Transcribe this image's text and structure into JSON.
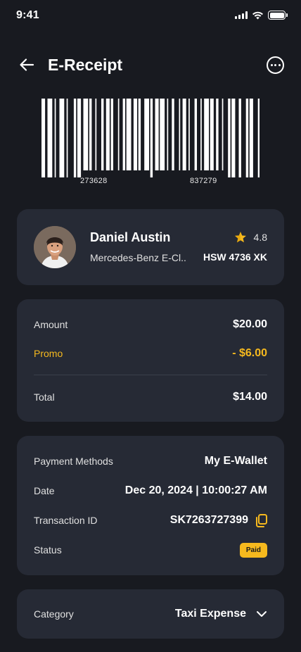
{
  "status_bar": {
    "time": "9:41"
  },
  "header": {
    "title": "E-Receipt"
  },
  "barcode": {
    "left_number": "273628",
    "right_number": "837279"
  },
  "driver": {
    "name": "Daniel Austin",
    "car": "Mercedes-Benz E-Cl..",
    "rating": "4.8",
    "plate": "HSW 4736 XK"
  },
  "amounts": {
    "amount_label": "Amount",
    "amount_value": "$20.00",
    "promo_label": "Promo",
    "promo_value": "- $6.00",
    "total_label": "Total",
    "total_value": "$14.00"
  },
  "payment": {
    "method_label": "Payment Methods",
    "method_value": "My E-Wallet",
    "date_label": "Date",
    "date_value": "Dec 20, 2024 | 10:00:27 AM",
    "txn_label": "Transaction ID",
    "txn_value": "SK7263727399",
    "status_label": "Status",
    "status_value": "Paid"
  },
  "category": {
    "label": "Category",
    "value": "Taxi Expense"
  },
  "colors": {
    "background": "#181a20",
    "card": "#262a35",
    "accent": "#f6b91e",
    "text": "#ffffff"
  },
  "icons": [
    "back-arrow-icon",
    "more-options-icon",
    "star-icon",
    "copy-icon",
    "chevron-down-icon"
  ]
}
